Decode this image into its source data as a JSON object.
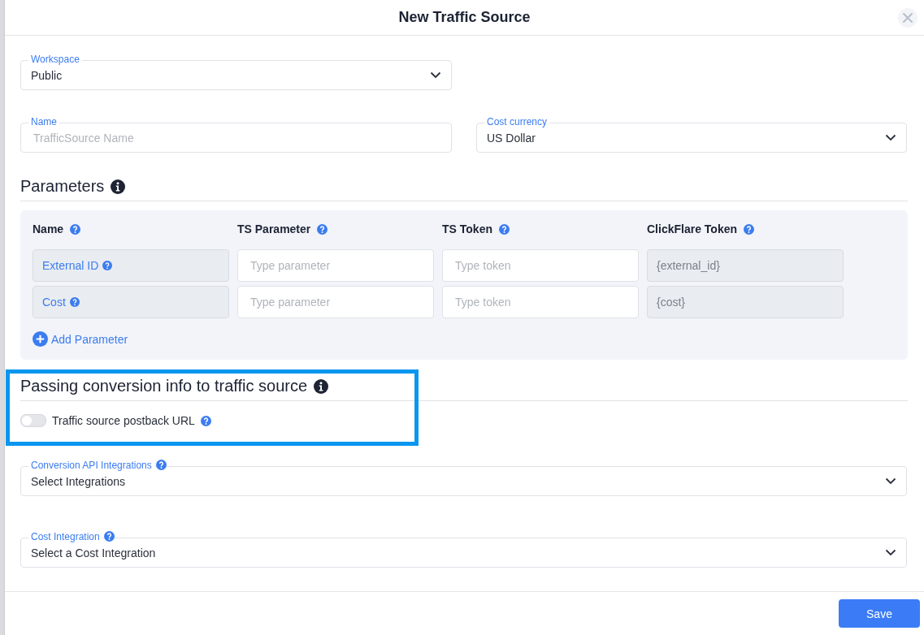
{
  "dialog": {
    "title": "New Traffic Source"
  },
  "workspace": {
    "label": "Workspace",
    "value": "Public"
  },
  "name_field": {
    "label": "Name",
    "placeholder": "TrafficSource Name"
  },
  "cost_currency": {
    "label": "Cost currency",
    "value": "US Dollar"
  },
  "parameters": {
    "title": "Parameters",
    "columns": [
      "Name",
      "TS Parameter",
      "TS Token",
      "ClickFlare Token"
    ],
    "rows": [
      {
        "name": "External ID",
        "ts_parameter_placeholder": "Type parameter",
        "ts_token_placeholder": "Type token",
        "clickflare_token": "{external_id}"
      },
      {
        "name": "Cost",
        "ts_parameter_placeholder": "Type parameter",
        "ts_token_placeholder": "Type token",
        "clickflare_token": "{cost}"
      }
    ],
    "add_button": "Add Parameter"
  },
  "conversion": {
    "title": "Passing conversion info to traffic source",
    "postback": {
      "label": "Traffic source postback URL",
      "on": false
    }
  },
  "conversion_api": {
    "label": "Conversion API Integrations",
    "value": "Select Integrations"
  },
  "cost_integration": {
    "label": "Cost Integration",
    "value": "Select a Cost Integration"
  },
  "buttons": {
    "save": "Save"
  }
}
